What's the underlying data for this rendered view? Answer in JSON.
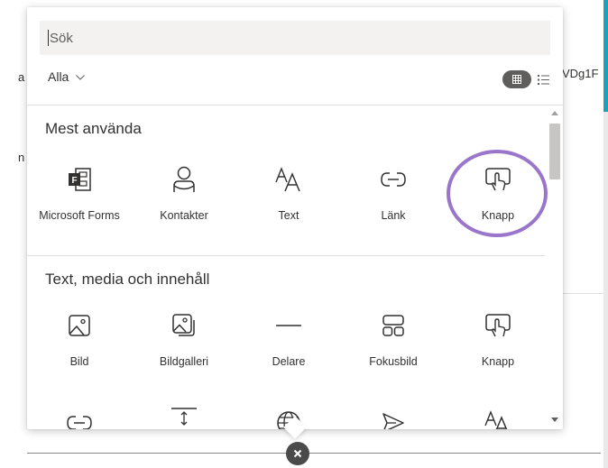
{
  "background": {
    "left_fragment_1": "a",
    "left_fragment_2": "n",
    "right_fragment": "VDg1F"
  },
  "panel": {
    "search": {
      "placeholder": "Sök"
    },
    "filter": {
      "selected": "Alla"
    },
    "sections": [
      {
        "title": "Mest använda",
        "items": [
          {
            "label": "Microsoft Forms",
            "icon": "forms-icon"
          },
          {
            "label": "Kontakter",
            "icon": "person-icon"
          },
          {
            "label": "Text",
            "icon": "text-icon"
          },
          {
            "label": "Länk",
            "icon": "link-icon"
          },
          {
            "label": "Knapp",
            "icon": "button-icon"
          }
        ]
      },
      {
        "title": "Text, media och innehåll",
        "items": [
          {
            "label": "Bild",
            "icon": "image-icon"
          },
          {
            "label": "Bildgalleri",
            "icon": "gallery-icon"
          },
          {
            "label": "Delare",
            "icon": "divider-icon"
          },
          {
            "label": "Fokusbild",
            "icon": "hero-icon"
          },
          {
            "label": "Knapp",
            "icon": "button-icon"
          }
        ]
      }
    ],
    "next_row_icons": [
      "link-icon",
      "spacer-icon",
      "globe-icon",
      "send-icon",
      "text-icon"
    ]
  },
  "colors": {
    "accent": "#1aa2b8",
    "highlight": "#9a76cb",
    "toggle_active": "#605e5c"
  }
}
